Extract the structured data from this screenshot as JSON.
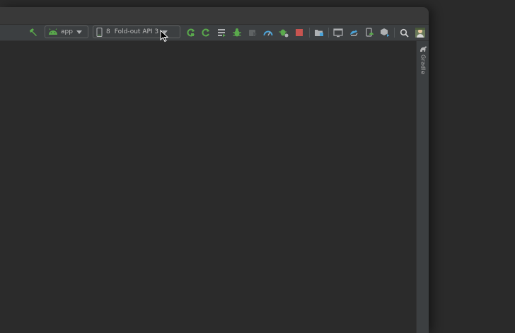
{
  "toolbar": {
    "run_config": {
      "label": "app"
    },
    "device": {
      "number": "8",
      "label": "Fold-out API 3"
    },
    "icons": [
      "hammer-icon",
      "android-icon",
      "device-icon",
      "apply-changes-restart-icon",
      "apply-code-changes-icon",
      "run-menu-icon",
      "debug-icon",
      "attach-debugger-icon",
      "profiler-icon",
      "bug-settings-icon",
      "stop-icon",
      "project-structure-icon",
      "device-manager-icon",
      "sync-project-icon",
      "avd-manager-icon",
      "sdk-manager-icon",
      "search-icon",
      "avatar-icon"
    ]
  },
  "side_panel": {
    "gradle_label": "Gradle"
  },
  "colors": {
    "accent_green": "#5aa94c",
    "stop_red": "#c75450",
    "blue": "#4aa3d8"
  }
}
